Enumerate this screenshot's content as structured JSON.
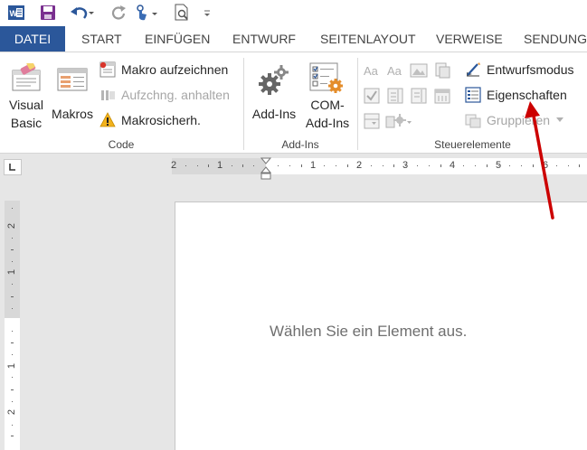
{
  "quick_access": {
    "app_icon": "word-icon",
    "save_icon": "save-icon",
    "undo_icon": "undo-icon",
    "redo_icon": "redo-icon",
    "touch_icon": "touch-mode-icon",
    "preview_icon": "print-preview-icon",
    "customize_icon": "customize-qat-icon"
  },
  "tabs": [
    {
      "label": "DATEI"
    },
    {
      "label": "START"
    },
    {
      "label": "EINFÜGEN"
    },
    {
      "label": "ENTWURF"
    },
    {
      "label": "SEITENLAYOUT"
    },
    {
      "label": "VERWEISE"
    },
    {
      "label": "SENDUNG"
    }
  ],
  "ribbon": {
    "code": {
      "label": "Code",
      "visual_basic": {
        "line1": "Visual",
        "line2": "Basic"
      },
      "makros": "Makros",
      "record_macro": "Makro aufzeichnen",
      "pause_recording": "Aufzchng. anhalten",
      "macro_security": "Makrosicherh."
    },
    "addins": {
      "label": "Add-Ins",
      "addins_button": "Add-Ins",
      "com_addins": {
        "line1": "COM-",
        "line2": "Add-Ins"
      }
    },
    "controls": {
      "label": "Steuerelemente",
      "design_mode": "Entwurfsmodus",
      "properties": "Eigenschaften",
      "group": "Gruppieren"
    }
  },
  "ruler": {
    "h_labels": [
      "2",
      "1",
      "1",
      "2",
      "3",
      "4",
      "5",
      "6"
    ],
    "v_labels": [
      "2",
      "1",
      "1",
      "2"
    ]
  },
  "document": {
    "placeholder": "Wählen Sie ein Element aus."
  },
  "colors": {
    "accent": "#2b579a",
    "arrow": "#cc0000"
  }
}
